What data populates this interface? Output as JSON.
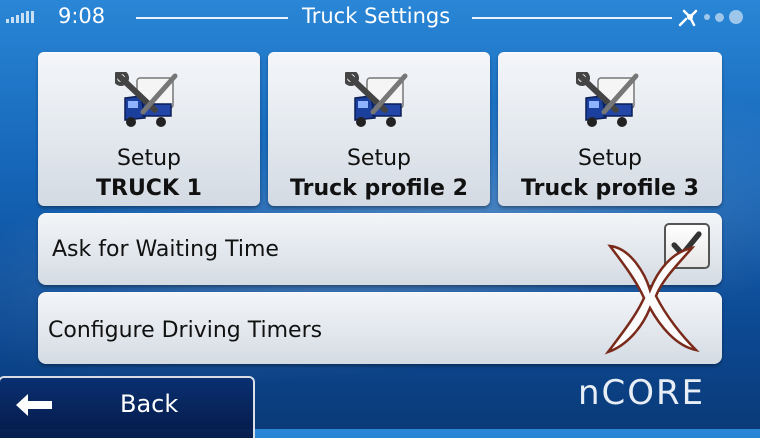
{
  "statusbar": {
    "time": "9:08",
    "title": "Truck Settings"
  },
  "tiles": [
    {
      "line1": "Setup",
      "line2": "TRUCK 1",
      "icon": "truck-wrench-icon"
    },
    {
      "line1": "Setup",
      "line2": "Truck profile 2",
      "icon": "truck-wrench-icon"
    },
    {
      "line1": "Setup",
      "line2": "Truck profile 3",
      "icon": "truck-wrench-icon"
    }
  ],
  "rows": {
    "waiting": {
      "label": "Ask for Waiting Time",
      "checked": true
    },
    "timers": {
      "label": "Configure Driving Timers"
    }
  },
  "footer": {
    "back_label": "Back",
    "brand": "nCORE"
  },
  "colors": {
    "background": "#1565b8",
    "tile": "#e3e8ee",
    "truck": "#1b3f9c"
  }
}
